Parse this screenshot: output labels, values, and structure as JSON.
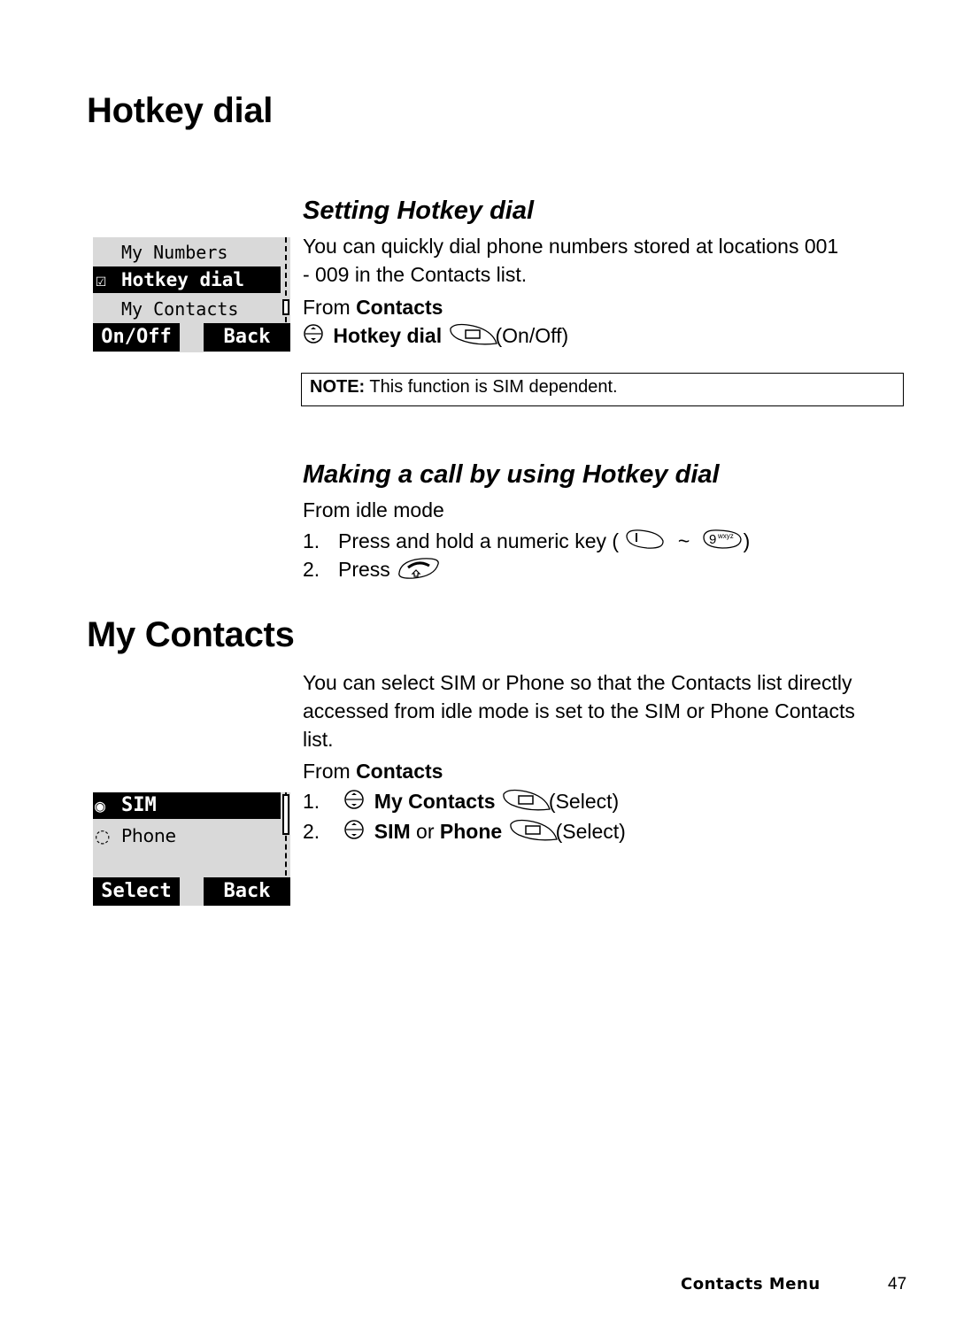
{
  "hotkey_section": {
    "title": "Hotkey dial",
    "sub1": {
      "title": "Setting Hotkey dial",
      "body_line1": "You can quickly dial phone numbers stored at locations 001",
      "body_line2": "- 009 in the Contacts list.",
      "from_prefix": "From ",
      "from_menu": "Contacts",
      "step_item": "Hotkey dial",
      "step_action": "(On/Off)",
      "note_label": "NOTE:",
      "note_text": " This function is SIM dependent."
    },
    "screen": {
      "items": [
        "My Numbers",
        "Hotkey dial",
        "My Contacts"
      ],
      "selected_index": 1,
      "selected_checked": true,
      "left_soft": "On/Off",
      "right_soft": "Back"
    },
    "sub2": {
      "title": "Making a call by using Hotkey dial",
      "from": "From idle mode",
      "step1_num": "1.",
      "step1_text": "Press and hold a numeric key (",
      "step1_key_from": "1",
      "step1_tilde": "~",
      "step1_key_to": "9",
      "step1_key_to_letters": "wxyz",
      "step1_close": ")",
      "step2_num": "2.",
      "step2_text": "Press"
    }
  },
  "contacts_section": {
    "title": "My Contacts",
    "body_line1": "You can select SIM or Phone so that the Contacts list directly",
    "body_line2": "accessed from idle mode is set to the SIM or Phone Contacts",
    "body_line3": "list.",
    "from_prefix": "From ",
    "from_menu": "Contacts",
    "step1_num": "1.",
    "step1_item": "My Contacts",
    "step1_action": "(Select)",
    "step2_num": "2.",
    "step2_item_a": "SIM",
    "step2_or": " or ",
    "step2_item_b": "Phone",
    "step2_action": "(Select)",
    "screen": {
      "options": [
        "SIM",
        "Phone"
      ],
      "selected_index": 0,
      "left_soft": "Select",
      "right_soft": "Back"
    }
  },
  "footer": {
    "section": "Contacts Menu",
    "page": "47"
  }
}
